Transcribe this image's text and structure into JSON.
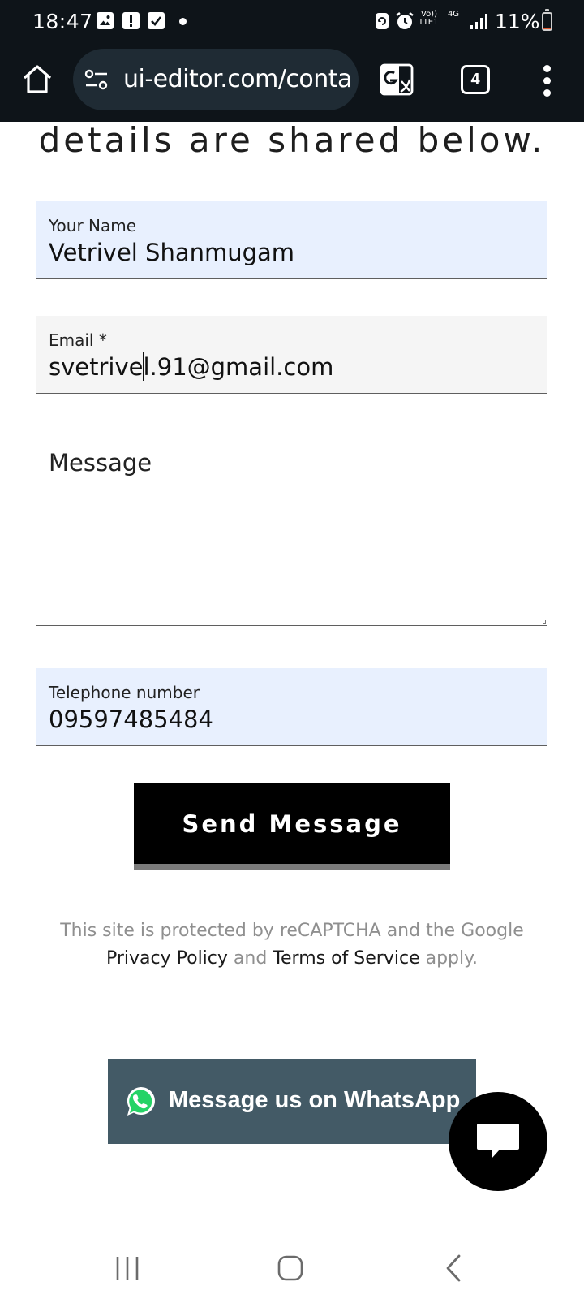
{
  "status_bar": {
    "time": "18:47",
    "network_label_top": "Vo)) LTE1",
    "network_label_mid": "4G",
    "battery_percent": "11%",
    "battery_level": 0.11,
    "icons": [
      "image-icon",
      "alert-icon",
      "checkbox-icon",
      "dot-icon",
      "sync-icon",
      "alarm-icon",
      "signal-icon",
      "battery-icon"
    ]
  },
  "browser": {
    "url": "ui-editor.com/contac",
    "tab_count": "4",
    "icons": [
      "home-icon",
      "site-settings-icon",
      "translate-icon",
      "tabs-icon",
      "more-menu-icon"
    ]
  },
  "page": {
    "heading": "details are shared below.",
    "form": {
      "name": {
        "label": "Your Name",
        "value": "Vetrivel Shanmugam"
      },
      "email": {
        "label": "Email *",
        "value": "svetrivel.91@gmail.com"
      },
      "message": {
        "label": "Message",
        "value": ""
      },
      "phone": {
        "label": "Telephone number",
        "value": "09597485484"
      },
      "submit_label": "Send Message"
    },
    "legal": {
      "prefix": "This site is protected by reCAPTCHA and the Google",
      "privacy_link": "Privacy Policy",
      "and": "and",
      "terms_link": "Terms of Service",
      "suffix": "apply."
    },
    "whatsapp_label": "Message us on WhatsApp"
  },
  "colors": {
    "system_bar": "#0e1419",
    "url_bar": "#1f2b34",
    "autofill_field": "#e8f0fe",
    "email_field": "#f5f5f5",
    "button": "#000000",
    "whatsapp_bg": "#435a66",
    "whatsapp_green": "#25d366",
    "battery_low": "#e0582f"
  }
}
